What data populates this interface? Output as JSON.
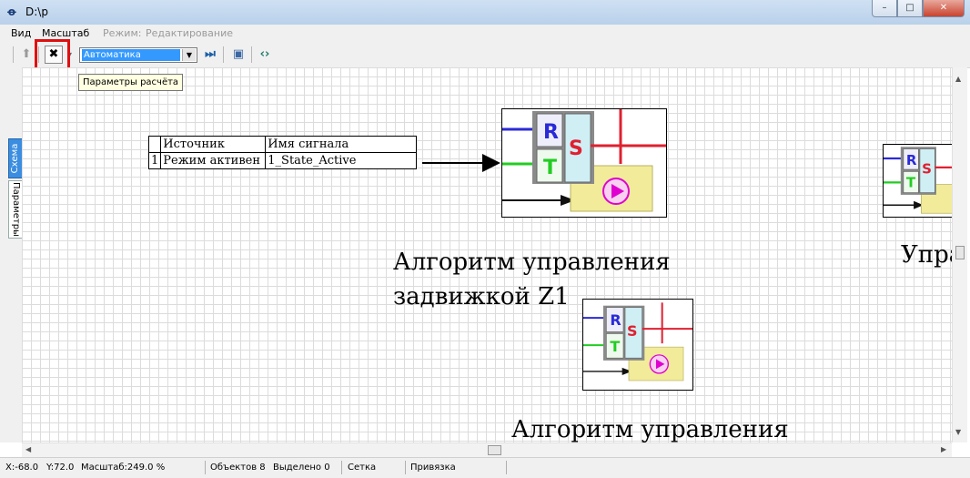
{
  "window": {
    "title": "D:\\р"
  },
  "menu": {
    "items": [
      "Вид",
      "Масштаб"
    ],
    "mode_label": "Режим:",
    "mode_value": "Редактирование"
  },
  "toolbar": {
    "calc_mode_value": "Автоматика",
    "tooltip": "Параметры расчёта"
  },
  "side_tabs": {
    "schema": "Схема",
    "params": "Параметры"
  },
  "table": {
    "headers": [
      "",
      "Источник",
      "Имя сигнала"
    ],
    "row": [
      "1",
      "Режим активен",
      "1_State_Active"
    ]
  },
  "block_icon": {
    "letters": [
      "R",
      "T",
      "S"
    ],
    "colors": {
      "blue": "#2a2ad8",
      "green": "#22cc22",
      "red": "#e02030",
      "yellow": "#f2ec9a",
      "magenta": "#e000d0",
      "cyan": "#cfeff5"
    }
  },
  "labels": {
    "algo1_line1": "Алгоритм управления",
    "algo1_line2": "задвижкой Z1",
    "algo2_line1": "Алгоритм управления",
    "right_partial": "Упра"
  },
  "status": {
    "x": "X:-68.0",
    "y": "Y:72.0",
    "zoom": "Масштаб:249.0 %",
    "objects": "Объектов 8",
    "selected": "Выделено 0",
    "grid": "Сетка",
    "snap": "Привязка"
  }
}
